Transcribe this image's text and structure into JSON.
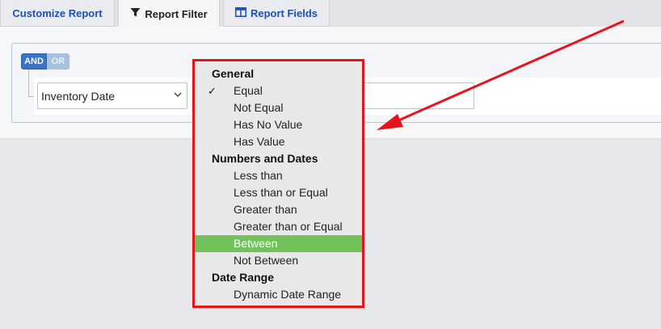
{
  "tabs": [
    {
      "label": "Customize Report",
      "icon": "none",
      "active": false
    },
    {
      "label": "Report Filter",
      "icon": "funnel-icon",
      "active": true
    },
    {
      "label": "Report Fields",
      "icon": "table-icon",
      "active": false
    }
  ],
  "filter": {
    "logic_and": "AND",
    "logic_or": "OR",
    "field_value": "Inventory Date",
    "value_input": ""
  },
  "operator_menu": {
    "checked": "Equal",
    "highlighted": "Between",
    "groups": [
      {
        "header": "General",
        "options": [
          "Equal",
          "Not Equal",
          "Has No Value",
          "Has Value"
        ]
      },
      {
        "header": "Numbers and Dates",
        "options": [
          "Less than",
          "Less than or Equal",
          "Greater than",
          "Greater than or Equal",
          "Between",
          "Not Between"
        ]
      },
      {
        "header": "Date Range",
        "options": [
          "Dynamic Date Range"
        ]
      }
    ]
  },
  "colors": {
    "link_blue": "#1e4fb4",
    "and_active": "#3874c6",
    "or_inactive": "#a8c1df",
    "highlight_green": "#72c15a",
    "annotation_red": "#e7141b"
  }
}
